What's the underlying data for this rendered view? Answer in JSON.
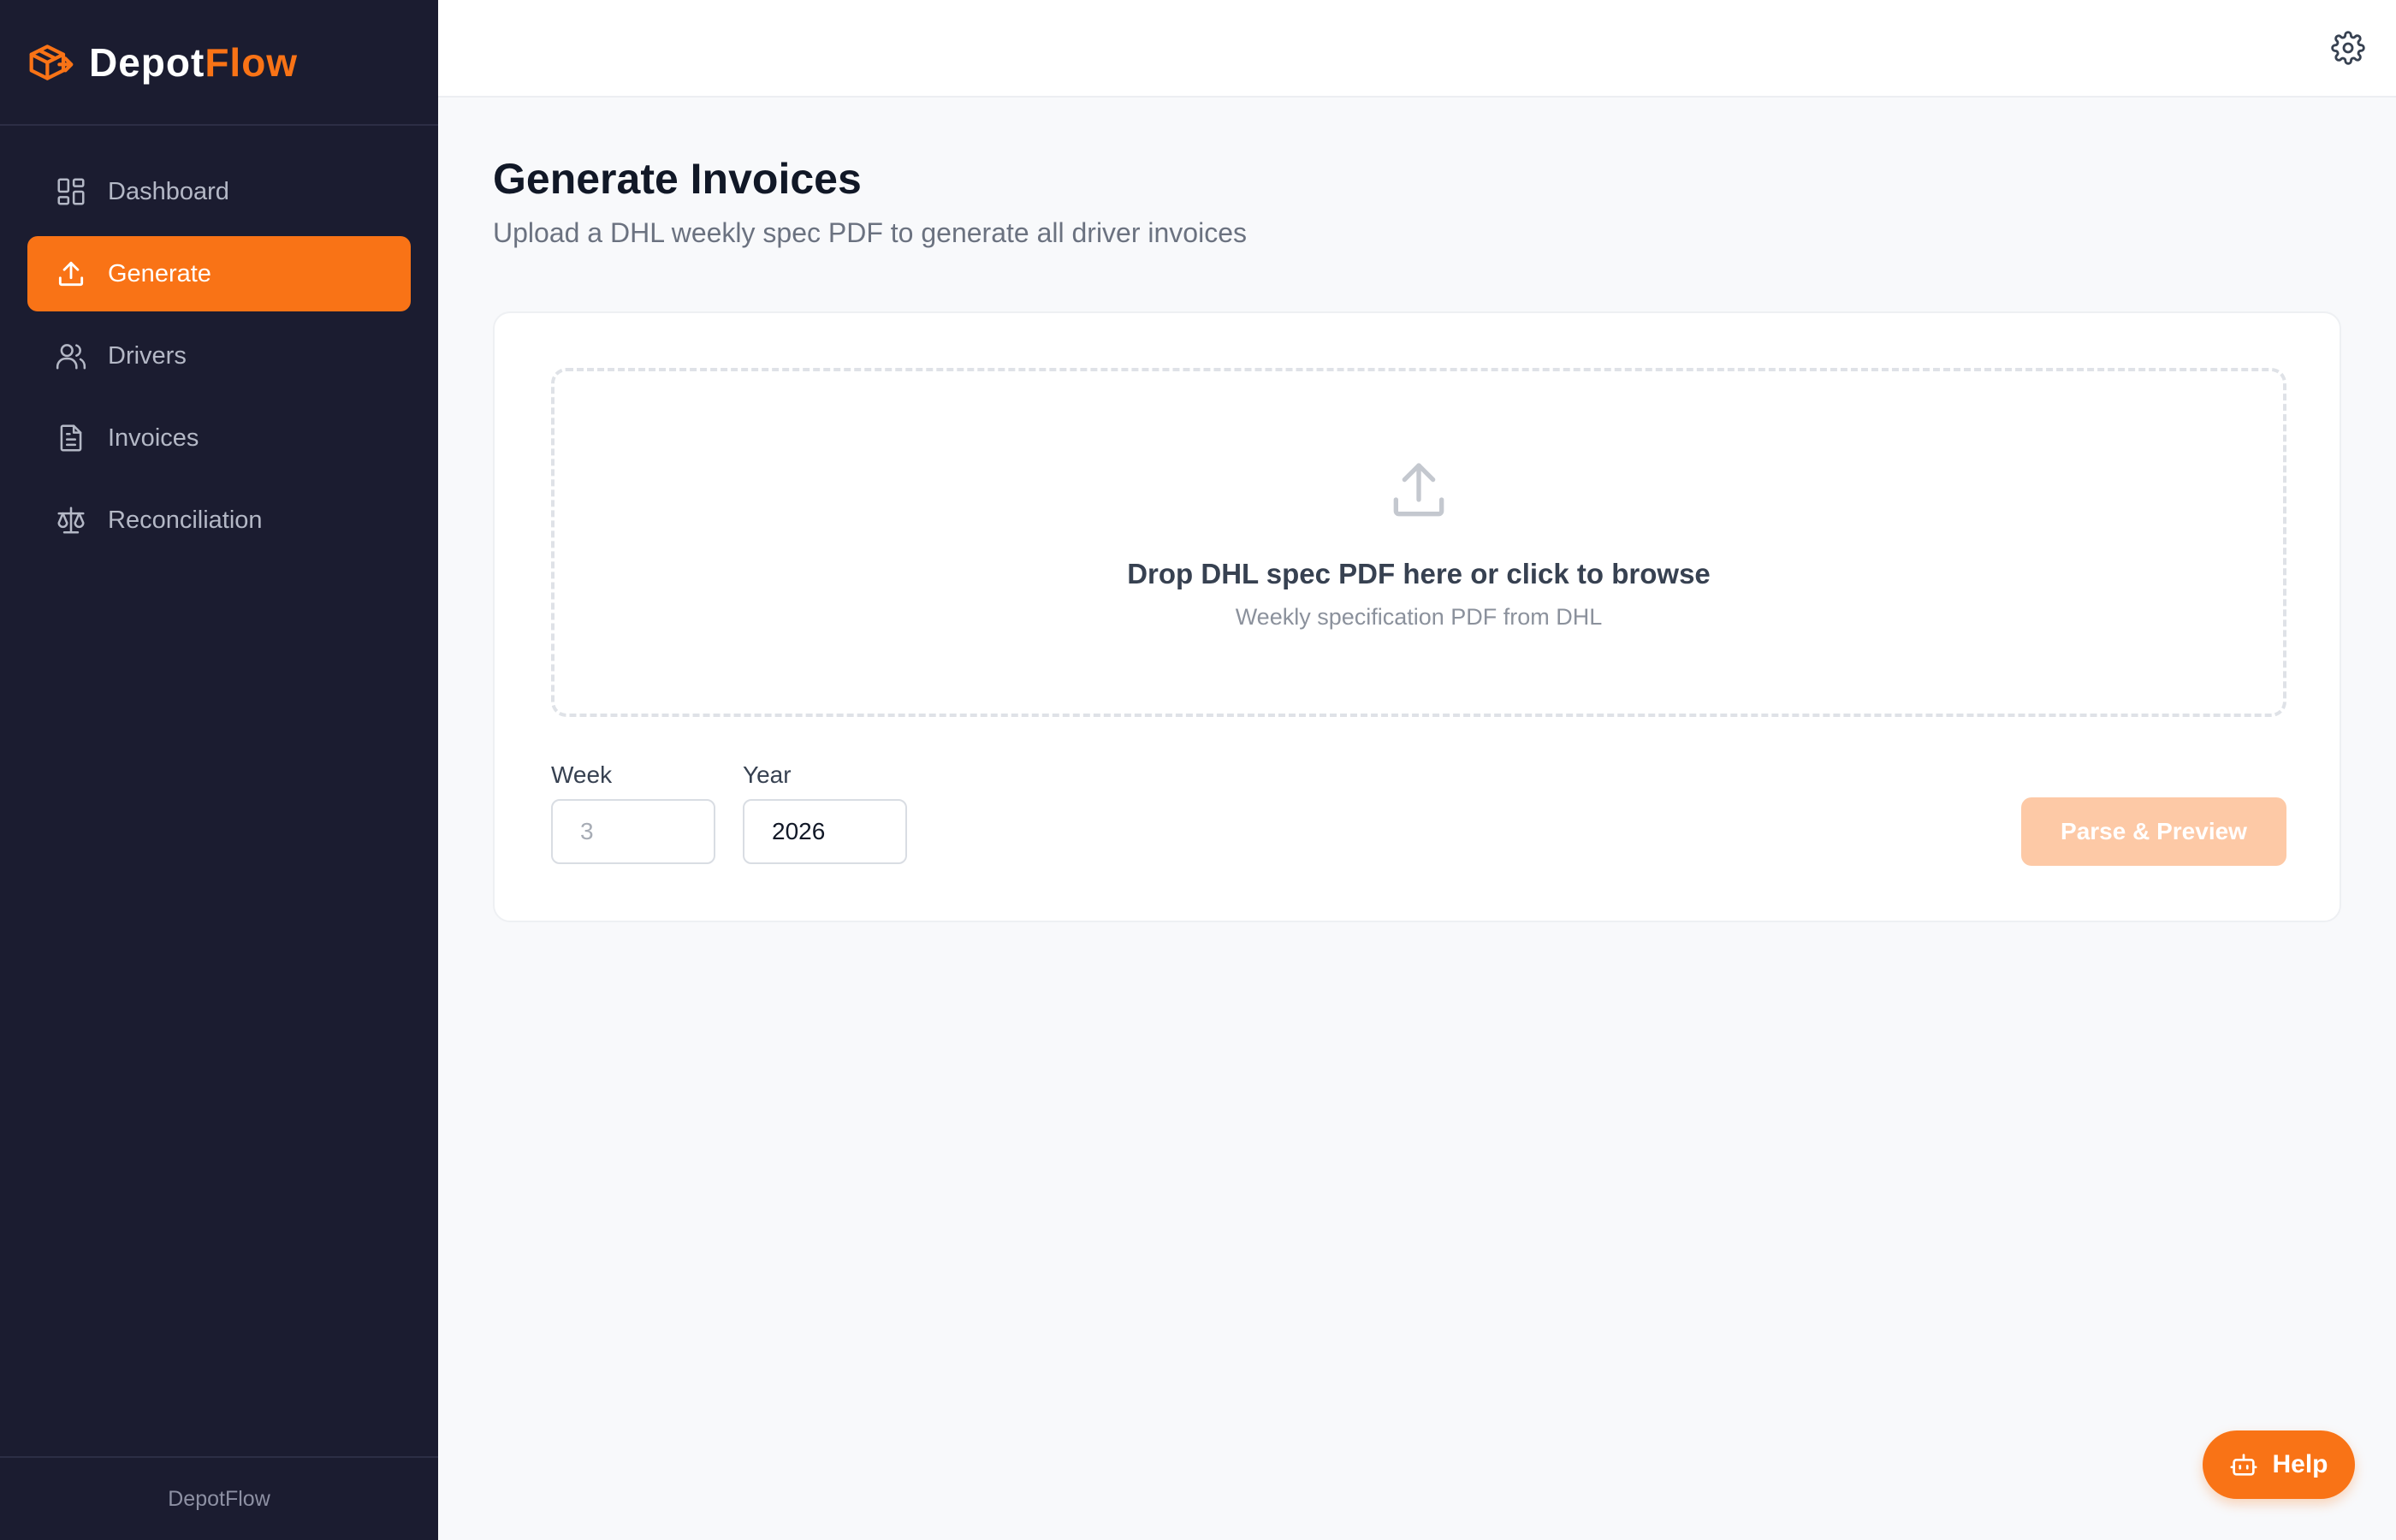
{
  "brand": {
    "name_part1": "Depot",
    "name_part2": "Flow",
    "accent_color": "#f97316"
  },
  "sidebar": {
    "items": [
      {
        "label": "Dashboard",
        "icon": "dashboard-grid-icon",
        "active": false
      },
      {
        "label": "Generate",
        "icon": "upload-icon",
        "active": true
      },
      {
        "label": "Drivers",
        "icon": "users-icon",
        "active": false
      },
      {
        "label": "Invoices",
        "icon": "document-icon",
        "active": false
      },
      {
        "label": "Reconciliation",
        "icon": "scale-icon",
        "active": false
      }
    ],
    "footer": "DepotFlow",
    "background": "#1b1c30"
  },
  "topbar": {
    "settings_icon": "gear-icon"
  },
  "main": {
    "title": "Generate Invoices",
    "subtitle": "Upload a DHL weekly spec PDF to generate all driver invoices",
    "dropzone": {
      "icon": "upload-icon",
      "title": "Drop DHL spec PDF here or click to browse",
      "subtitle": "Weekly specification PDF from DHL"
    },
    "week": {
      "label": "Week",
      "placeholder": "3",
      "value": ""
    },
    "year": {
      "label": "Year",
      "value": "2026"
    },
    "parse_button": {
      "label": "Parse & Preview",
      "disabled": true
    }
  },
  "help_button": {
    "label": "Help",
    "icon": "bot-icon"
  }
}
